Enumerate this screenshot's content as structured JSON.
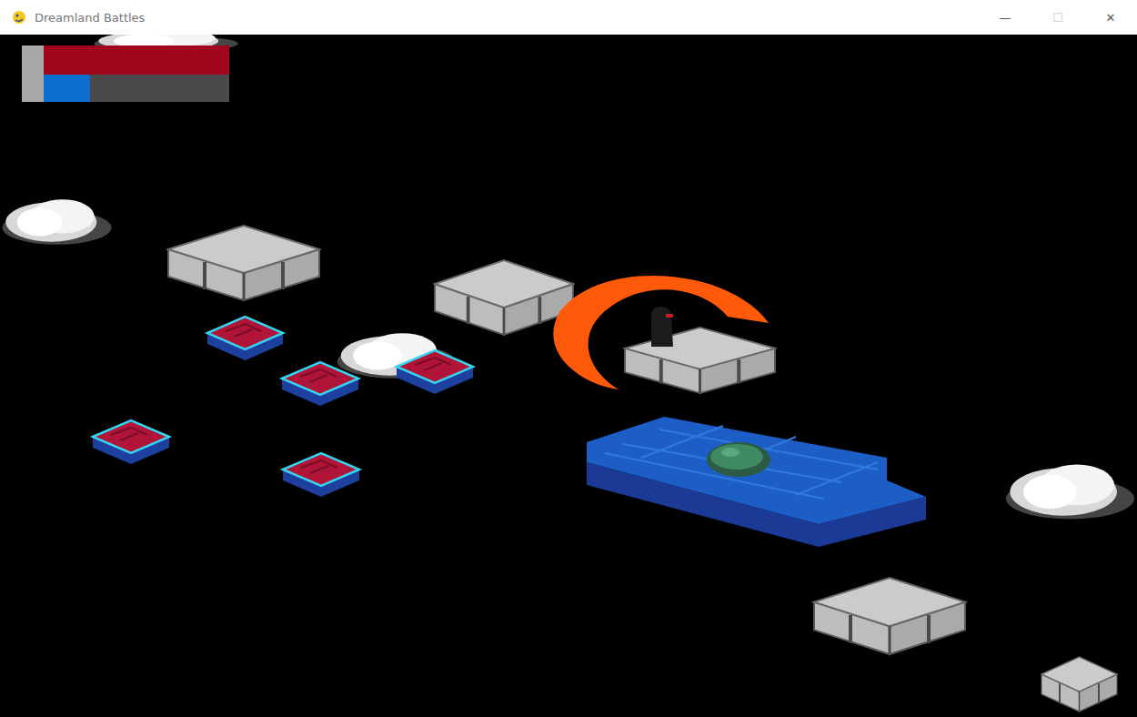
{
  "window": {
    "title": "Dreamland Battles",
    "controls": [
      {
        "label": "—",
        "disabled": false
      },
      {
        "label": "☐",
        "disabled": true
      },
      {
        "label": "✕",
        "disabled": false
      }
    ]
  },
  "hud": {
    "health": {
      "level": 1,
      "color": "#a0061e"
    },
    "mana": {
      "level": 0.25,
      "color": "#0a6fd0"
    }
  },
  "scene": {
    "objects": [
      {
        "kind": "cloud"
      },
      {
        "kind": "cloud"
      },
      {
        "kind": "cloud"
      },
      {
        "kind": "cloud"
      },
      {
        "kind": "stone-platform"
      },
      {
        "kind": "stone-platform"
      },
      {
        "kind": "red-tile"
      },
      {
        "kind": "red-tile"
      },
      {
        "kind": "red-tile"
      },
      {
        "kind": "red-tile"
      },
      {
        "kind": "red-tile"
      },
      {
        "kind": "water-pool"
      },
      {
        "kind": "slime"
      },
      {
        "kind": "stone-platform"
      },
      {
        "kind": "slash"
      },
      {
        "kind": "player"
      },
      {
        "kind": "stone-platform"
      },
      {
        "kind": "stone-platform"
      }
    ]
  }
}
